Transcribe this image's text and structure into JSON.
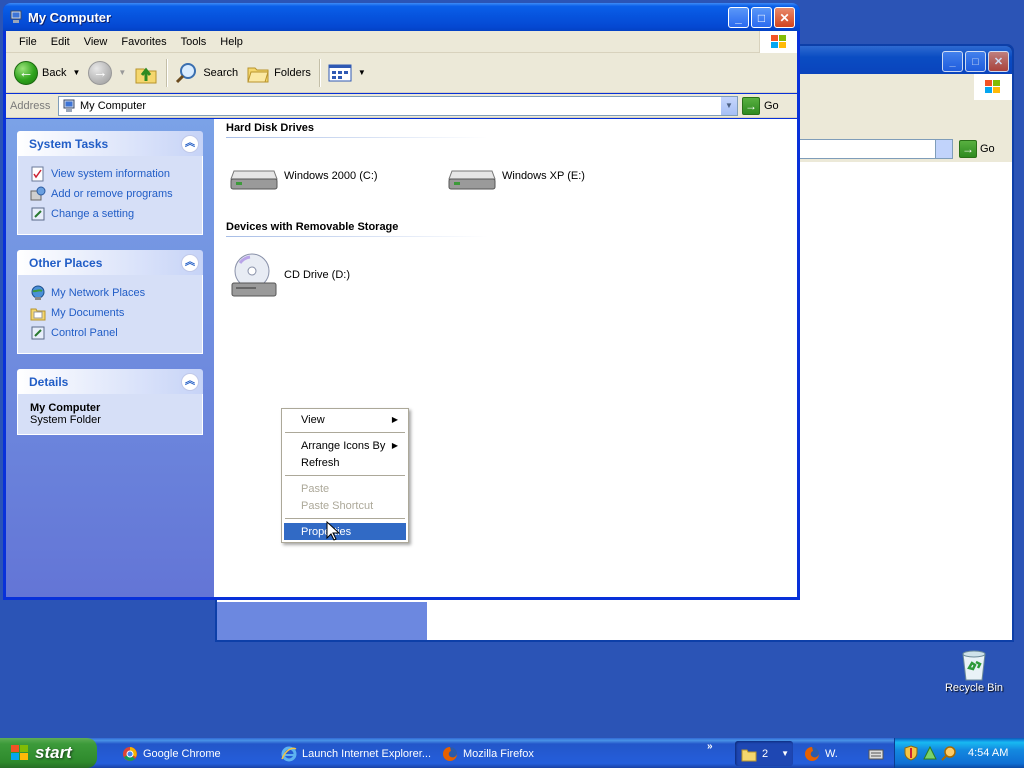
{
  "window": {
    "title": "My Computer",
    "menu": [
      "File",
      "Edit",
      "View",
      "Favorites",
      "Tools",
      "Help"
    ],
    "toolbar": {
      "back": "Back",
      "search": "Search",
      "folders": "Folders"
    },
    "address": {
      "label": "Address",
      "value": "My Computer",
      "go": "Go"
    }
  },
  "taskpane": {
    "system_tasks": {
      "title": "System Tasks",
      "items": [
        "View system information",
        "Add or remove programs",
        "Change a setting"
      ]
    },
    "other_places": {
      "title": "Other Places",
      "items": [
        "My Network Places",
        "My Documents",
        "Control Panel"
      ]
    },
    "details": {
      "title": "Details",
      "name": "My Computer",
      "type": "System Folder"
    }
  },
  "groups": {
    "hard_disks": {
      "title": "Hard Disk Drives",
      "items": [
        "Windows 2000 (C:)",
        "Windows XP (E:)"
      ]
    },
    "removable": {
      "title": "Devices with Removable Storage",
      "items": [
        "CD Drive (D:)"
      ]
    }
  },
  "context_menu": {
    "view": "View",
    "arrange": "Arrange Icons By",
    "refresh": "Refresh",
    "paste": "Paste",
    "paste_shortcut": "Paste Shortcut",
    "properties": "Properties"
  },
  "background_window": {
    "go": "Go"
  },
  "desktop": {
    "recycle_bin": "Recycle Bin"
  },
  "taskbar": {
    "start": "start",
    "tasks": [
      "Google Chrome",
      "Launch Internet Explorer...",
      "Mozilla Firefox"
    ],
    "folder_group_count": "2",
    "firefox_short": "W.",
    "clock": "4:54 AM"
  },
  "colors": {
    "titlebar": "#0a5ee8",
    "taskpane": "#7ba2e7",
    "link": "#215dc6",
    "menu_highlight": "#316ac5",
    "desktop": "#2b54b6",
    "start_green": "#3c9a3a"
  }
}
